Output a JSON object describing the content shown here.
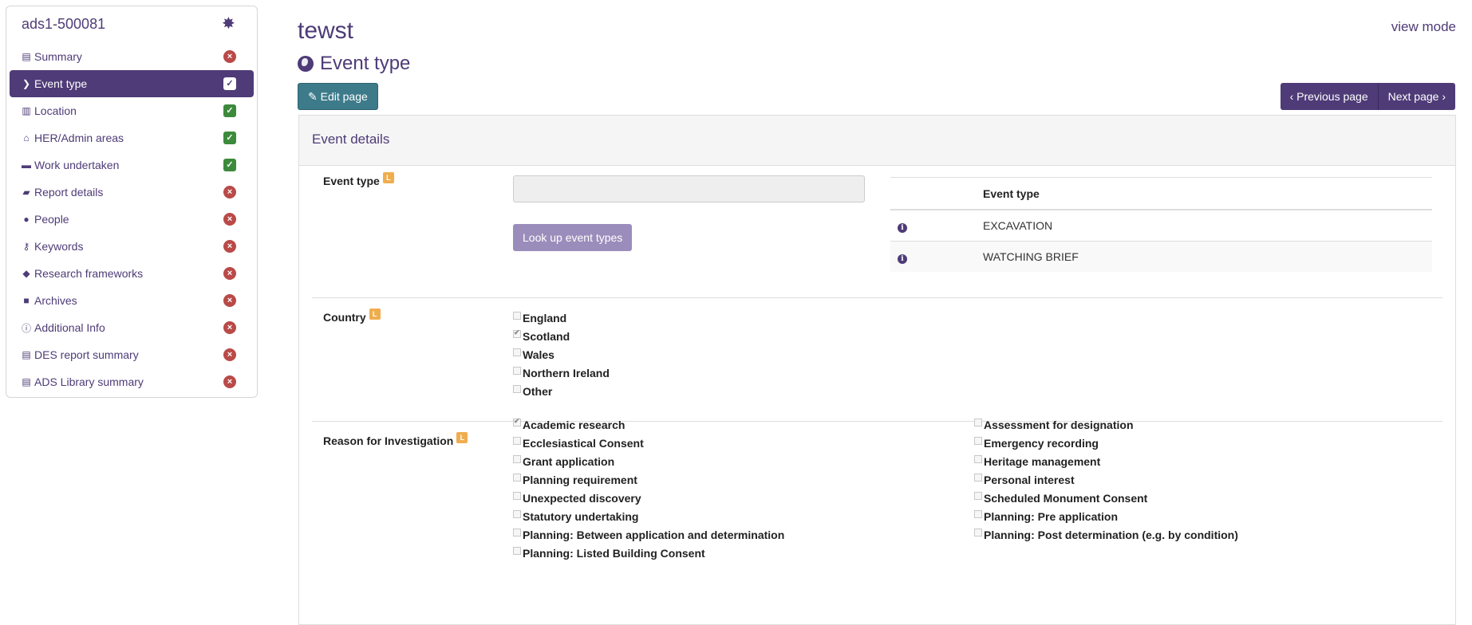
{
  "sidebar": {
    "title": "ads1-500081",
    "items": [
      {
        "label": "Summary",
        "status": "incomplete"
      },
      {
        "label": "Event type",
        "status": "complete",
        "active": true
      },
      {
        "label": "Location",
        "status": "complete"
      },
      {
        "label": "HER/Admin areas",
        "status": "complete"
      },
      {
        "label": "Work undertaken",
        "status": "complete"
      },
      {
        "label": "Report details",
        "status": "incomplete"
      },
      {
        "label": "People",
        "status": "incomplete"
      },
      {
        "label": "Keywords",
        "status": "incomplete"
      },
      {
        "label": "Research frameworks",
        "status": "incomplete"
      },
      {
        "label": "Archives",
        "status": "incomplete"
      },
      {
        "label": "Additional Info",
        "status": "incomplete"
      },
      {
        "label": "DES report summary",
        "status": "incomplete"
      },
      {
        "label": "ADS Library summary",
        "status": "incomplete"
      }
    ]
  },
  "header": {
    "title": "tewst",
    "view_mode": "view mode",
    "section": "Event type",
    "edit_label": "Edit page",
    "prev_label": "‹ Previous page",
    "next_label": "Next page ›"
  },
  "panel": {
    "title": "Event details",
    "event_type": {
      "label": "Event type",
      "lookup_label": "Look up event types",
      "table_header": "Event type",
      "rows": [
        "EXCAVATION",
        "WATCHING BRIEF"
      ]
    },
    "country": {
      "label": "Country",
      "options": [
        {
          "label": "England",
          "checked": false
        },
        {
          "label": "Scotland",
          "checked": true
        },
        {
          "label": "Wales",
          "checked": false
        },
        {
          "label": "Northern Ireland",
          "checked": false
        },
        {
          "label": "Other",
          "checked": false
        }
      ]
    },
    "reason": {
      "label": "Reason for Investigation",
      "left": [
        {
          "label": "Academic research",
          "checked": true
        },
        {
          "label": "Ecclesiastical Consent",
          "checked": false
        },
        {
          "label": "Grant application",
          "checked": false
        },
        {
          "label": "Planning requirement",
          "checked": false
        },
        {
          "label": "Unexpected discovery",
          "checked": false
        },
        {
          "label": "Statutory undertaking",
          "checked": false
        },
        {
          "label": "Planning: Between application and determination",
          "checked": false
        },
        {
          "label": "Planning: Listed Building Consent",
          "checked": false
        }
      ],
      "right": [
        {
          "label": "Assessment for designation",
          "checked": false
        },
        {
          "label": "Emergency recording",
          "checked": false
        },
        {
          "label": "Heritage management",
          "checked": false
        },
        {
          "label": "Personal interest",
          "checked": false
        },
        {
          "label": "Scheduled Monument Consent",
          "checked": false
        },
        {
          "label": "Planning: Pre application",
          "checked": false
        },
        {
          "label": "Planning: Post determination (e.g. by condition)",
          "checked": false
        }
      ]
    }
  }
}
